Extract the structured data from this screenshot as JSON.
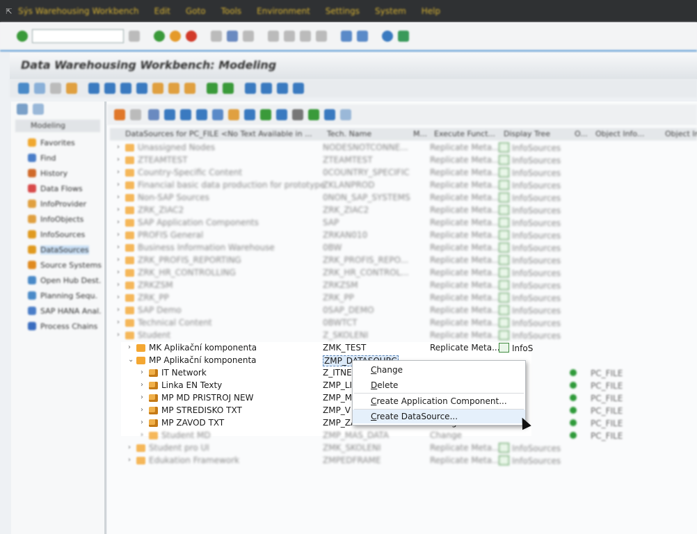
{
  "menubar": {
    "items": [
      "Sýs Warehousing Workbench",
      "Edit",
      "Goto",
      "Tools",
      "Environment",
      "Settings",
      "System",
      "Help"
    ]
  },
  "window": {
    "title": "Data Warehousing Workbench: Modeling"
  },
  "left_panel": {
    "header": "Modeling",
    "items": [
      {
        "label": "Favorites",
        "color": "#f0a830"
      },
      {
        "label": "Find",
        "color": "#4a7dc8"
      },
      {
        "label": "History",
        "color": "#d06a2a"
      },
      {
        "label": "Data Flows",
        "color": "#d84a4a"
      },
      {
        "label": "InfoProvider",
        "color": "#e0a040"
      },
      {
        "label": "InfoObjects",
        "color": "#e0a040"
      },
      {
        "label": "InfoSources",
        "color": "#e09a20"
      },
      {
        "label": "DataSources",
        "color": "#e09a20"
      },
      {
        "label": "Source Systems",
        "color": "#e08a20"
      },
      {
        "label": "Open Hub Dest.",
        "color": "#4a8ac8"
      },
      {
        "label": "Planning Sequ.",
        "color": "#4a8ac8"
      },
      {
        "label": "SAP HANA Anal.",
        "color": "#4a7dc8"
      },
      {
        "label": "Process Chains",
        "color": "#3a6dc0"
      }
    ],
    "selected_index": 7
  },
  "columns": {
    "name": "DataSources for PC_FILE <No Text Available in ...",
    "tech": "Tech. Name",
    "m": "M...",
    "exec": "Execute Funct...",
    "display": "Display Tree",
    "o": "O...",
    "objinfo": "Object Info...",
    "objinfo2": "Object In..."
  },
  "tree": {
    "blurred_rows": [
      {
        "name": "Unassigned Nodes",
        "tech": "NODESNOTCONNE...",
        "exec": "Replicate Meta...",
        "display": "InfoSources"
      },
      {
        "name": "ZTEAMTEST",
        "tech": "ZTEAMTEST",
        "exec": "Replicate Meta...",
        "display": "InfoSources"
      },
      {
        "name": "Country-Specific Content",
        "tech": "0COUNTRY_SPECIFIC",
        "exec": "Replicate Meta...",
        "display": "InfoSources"
      },
      {
        "name": "Financial basic data production for prototype",
        "tech": "ZKLANPROD",
        "exec": "Replicate Meta...",
        "display": "InfoSources"
      },
      {
        "name": "Non-SAP Sources",
        "tech": "0NON_SAP_SYSTEMS",
        "exec": "Replicate Meta...",
        "display": "InfoSources"
      },
      {
        "name": "ZRK_ZIAC2",
        "tech": "ZRK_ZIAC2",
        "exec": "Replicate Meta...",
        "display": "InfoSources"
      },
      {
        "name": "SAP Application Components",
        "tech": "SAP",
        "exec": "Replicate Meta...",
        "display": "InfoSources"
      },
      {
        "name": "PROFIS General",
        "tech": "ZRKAN010",
        "exec": "Replicate Meta...",
        "display": "InfoSources"
      },
      {
        "name": "Business Information Warehouse",
        "tech": "0BW",
        "exec": "Replicate Meta...",
        "display": "InfoSources"
      },
      {
        "name": "ZRK_PROFIS_REPORTING",
        "tech": "ZRK_PROFIS_REPO...",
        "exec": "Replicate Meta...",
        "display": "InfoSources"
      },
      {
        "name": "ZRK_HR_CONTROLLING",
        "tech": "ZRK_HR_CONTROL...",
        "exec": "Replicate Meta...",
        "display": "InfoSources"
      },
      {
        "name": "ZRKZSM",
        "tech": "ZRKZSM",
        "exec": "Replicate Meta...",
        "display": "InfoSources"
      },
      {
        "name": "ZRK_PP",
        "tech": "ZRK_PP",
        "exec": "Replicate Meta...",
        "display": "InfoSources"
      },
      {
        "name": "SAP Demo",
        "tech": "0SAP_DEMO",
        "exec": "Replicate Meta...",
        "display": "InfoSources"
      },
      {
        "name": "Technical Content",
        "tech": "0BWTCT",
        "exec": "Replicate Meta...",
        "display": "InfoSources"
      },
      {
        "name": "Student",
        "tech": "Z_SKOLENI",
        "exec": "Replicate Meta...",
        "display": "InfoSources"
      }
    ],
    "mk": {
      "name": "MK Aplikační komponenta",
      "tech": "ZMK_TEST",
      "exec": "Replicate Meta...",
      "display": "InfoS"
    },
    "mp": {
      "name": "MP Aplikační komponenta",
      "tech": "ZMP_DATASOURC"
    },
    "children": [
      {
        "name": "IT Network",
        "tech": "Z_ITNE"
      },
      {
        "name": "Linka EN Texty",
        "tech": "ZMP_LI"
      },
      {
        "name": "MP MD PRISTROJ NEW",
        "tech": "ZMP_MI"
      },
      {
        "name": "MP STREDISKO TXT",
        "tech": "ZMP_V"
      },
      {
        "name": "MP ZAVOD TXT",
        "tech": "ZMP_ZAVOD",
        "exec": "Change"
      }
    ],
    "tail_rows": [
      {
        "name": "Student MD",
        "tech": "ZMP_MAS_DATA",
        "exec": "Change"
      },
      {
        "name": "Student pro UI",
        "tech": "ZMK_SKOLENI",
        "exec": "Replicate Meta...",
        "display": "InfoSources"
      },
      {
        "name": "Edukation Framework",
        "tech": "ZMPEDFRAME",
        "exec": "Replicate Meta...",
        "display": "InfoSources"
      }
    ],
    "objinfo_label": "PC_FILE"
  },
  "context_menu": {
    "items": [
      "Change",
      "Delete",
      "Create Application Component...",
      "Create DataSource..."
    ],
    "highlighted_index": 3
  }
}
